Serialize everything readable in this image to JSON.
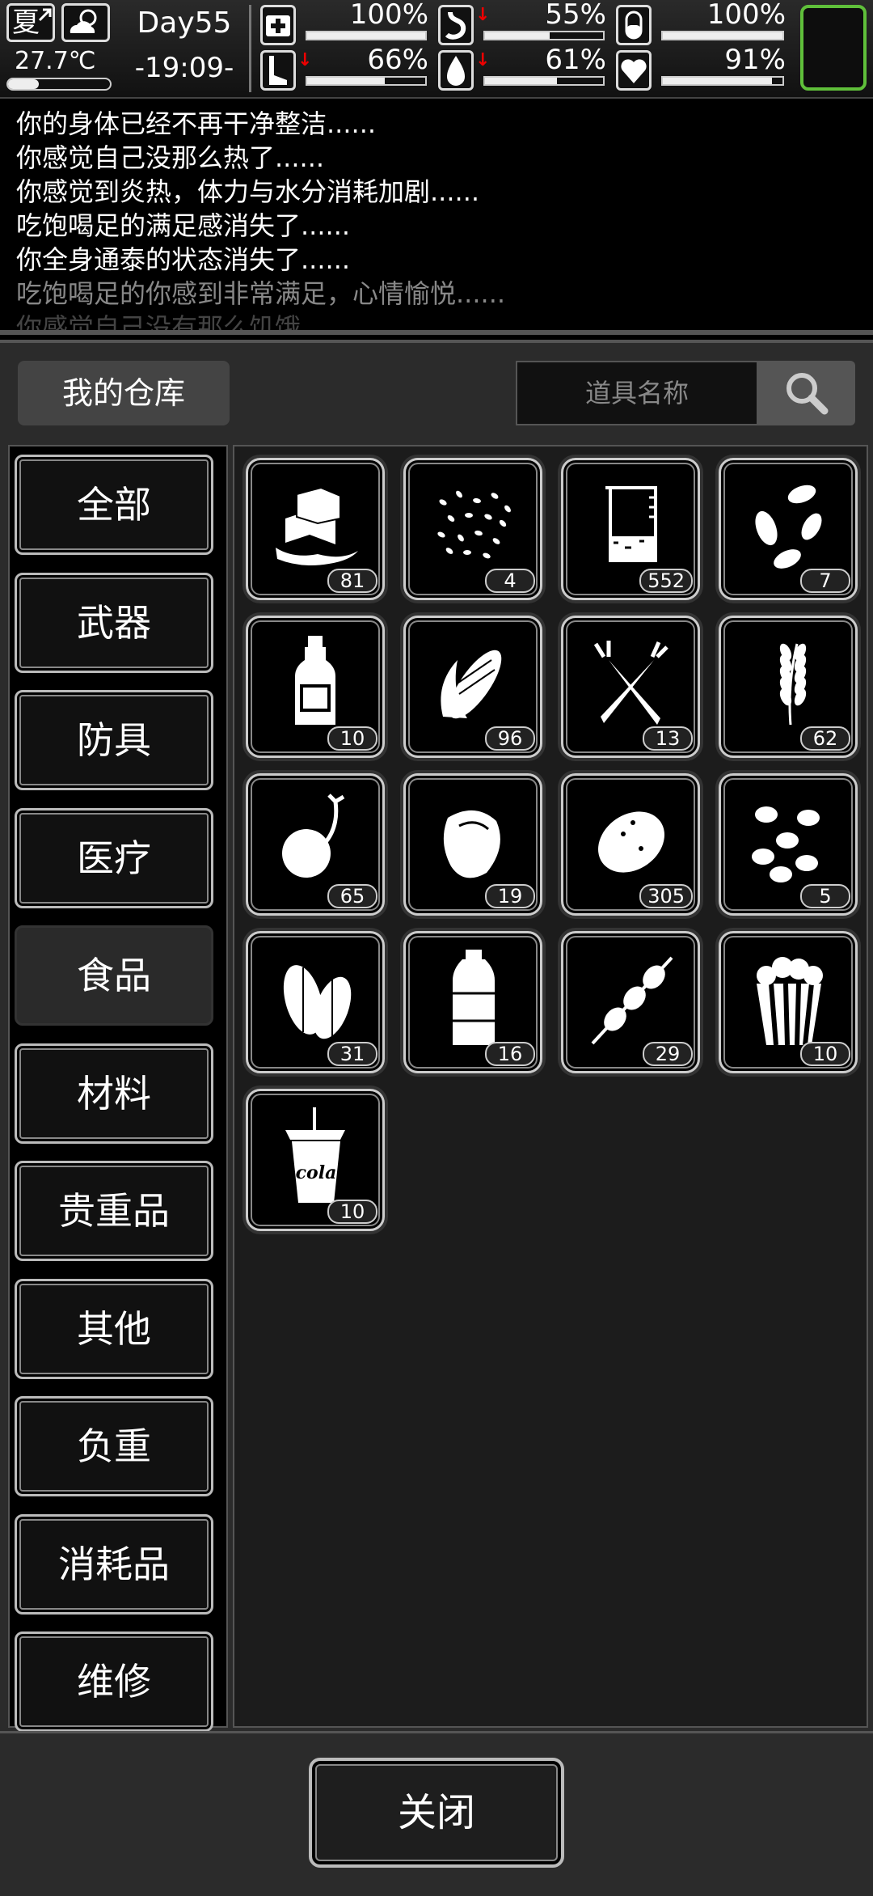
{
  "status": {
    "season": "夏",
    "temperature": "27.7℃",
    "day": "Day55",
    "time": "-19:09-",
    "stats": [
      {
        "name": "health",
        "value": "100%",
        "level": 1.0,
        "falling": false
      },
      {
        "name": "hunger",
        "value": "55%",
        "level": 0.55,
        "falling": true
      },
      {
        "name": "sanity",
        "value": "100%",
        "level": 1.0,
        "falling": false
      },
      {
        "name": "stamina",
        "value": "66%",
        "level": 0.66,
        "falling": true
      },
      {
        "name": "thirst",
        "value": "61%",
        "level": 0.61,
        "falling": true
      },
      {
        "name": "mood",
        "value": "91%",
        "level": 0.91,
        "falling": false
      }
    ],
    "temperature_level": 0.3
  },
  "log": [
    "你的身体已经不再干净整洁......",
    "你感觉自己没那么热了......",
    "你感觉到炎热，体力与水分消耗加剧......",
    "吃饱喝足的满足感消失了......",
    "你全身通泰的状态消失了......",
    "吃饱喝足的你感到非常满足，心情愉悦......",
    "你感觉自己没有那么饥饿......"
  ],
  "panel": {
    "title": "我的仓库",
    "search_placeholder": "道具名称",
    "categories": [
      "全部",
      "武器",
      "防具",
      "医疗",
      "食品",
      "材料",
      "贵重品",
      "其他",
      "负重",
      "消耗品",
      "维修"
    ],
    "active_category": "食品",
    "items": [
      {
        "icon": "ice-icon",
        "count": "81"
      },
      {
        "icon": "seeds-icon",
        "count": "4"
      },
      {
        "icon": "beaker-icon",
        "count": "552"
      },
      {
        "icon": "sunflower-seeds-icon",
        "count": "7"
      },
      {
        "icon": "bottle-icon",
        "count": "10"
      },
      {
        "icon": "corn-icon",
        "count": "96"
      },
      {
        "icon": "carrot-icon",
        "count": "13"
      },
      {
        "icon": "wheat-icon",
        "count": "62"
      },
      {
        "icon": "sprout-icon",
        "count": "65"
      },
      {
        "icon": "meat-icon",
        "count": "19"
      },
      {
        "icon": "potato-icon",
        "count": "305"
      },
      {
        "icon": "beans-icon",
        "count": "5"
      },
      {
        "icon": "nuts-icon",
        "count": "31"
      },
      {
        "icon": "water-bottle-icon",
        "count": "16"
      },
      {
        "icon": "skewer-icon",
        "count": "29"
      },
      {
        "icon": "popcorn-icon",
        "count": "10"
      },
      {
        "icon": "cola-icon",
        "count": "10",
        "label": "cola"
      }
    ],
    "close_label": "关闭"
  },
  "colors": {
    "accent_slot": "#5fbf3a",
    "arrow_down": "#e00000"
  }
}
